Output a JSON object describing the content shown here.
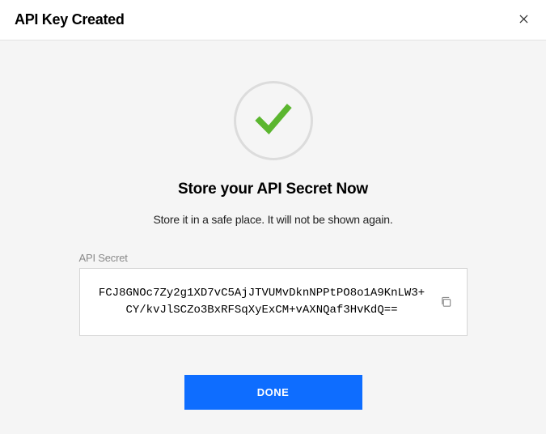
{
  "header": {
    "title": "API Key Created"
  },
  "body": {
    "subtitle": "Store your API Secret Now",
    "description": "Store it in a safe place. It will not be shown again.",
    "field_label": "API Secret",
    "secret_value": "FCJ8GNOc7Zy2g1XD7vC5AjJTVUMvDknNPPtPO8o1A9KnLW3+CY/kvJlSCZo3BxRFSqXyExCM+vAXNQaf3HvKdQ=="
  },
  "actions": {
    "done_label": "DONE"
  },
  "icons": {
    "check": "check-icon",
    "close": "close-icon",
    "copy": "copy-icon"
  },
  "colors": {
    "accent": "#0e6dff",
    "success": "#5bb62f"
  }
}
